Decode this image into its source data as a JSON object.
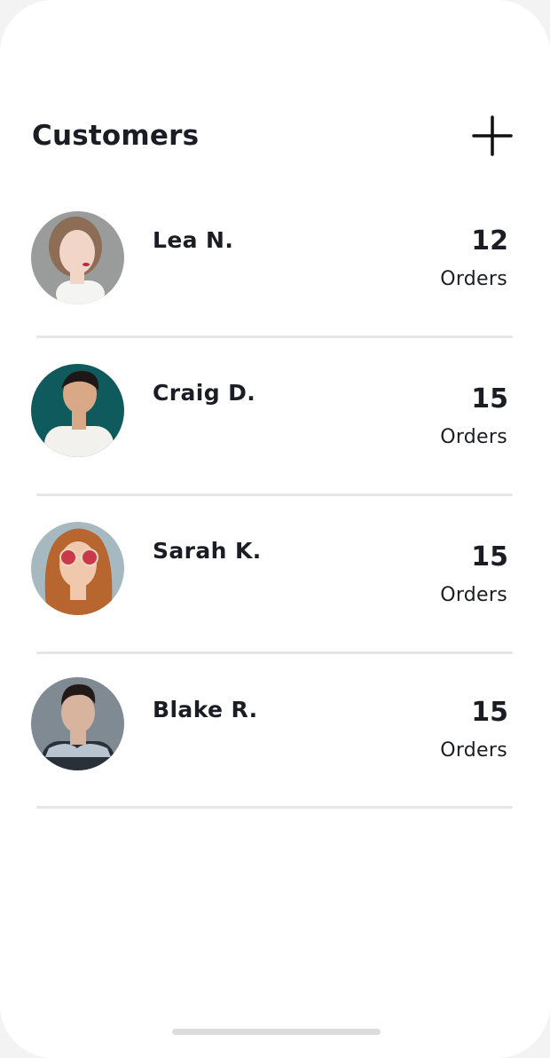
{
  "header": {
    "title": "Customers",
    "add_icon": "plus-icon"
  },
  "customers": [
    {
      "name": "Lea N.",
      "orders_count": "12",
      "orders_label": "Orders",
      "avatar": {
        "bg": "#9a9c9b",
        "skin": "#f1d6c8",
        "hair": "#8d6d55",
        "shirt": "#f4f4f2"
      }
    },
    {
      "name": "Craig D.",
      "orders_count": "15",
      "orders_label": "Orders",
      "avatar": {
        "bg": "#0f5a5c",
        "skin": "#d9a887",
        "hair": "#1d1715",
        "shirt": "#f3f1ee"
      }
    },
    {
      "name": "Sarah K.",
      "orders_count": "15",
      "orders_label": "Orders",
      "avatar": {
        "bg": "#a7b9c0",
        "skin": "#f0c8ac",
        "hair": "#b7662f",
        "shirt": "#d9a37c"
      }
    },
    {
      "name": "Blake R.",
      "orders_count": "15",
      "orders_label": "Orders",
      "avatar": {
        "bg": "#7f8a93",
        "skin": "#d8b49f",
        "hair": "#221a17",
        "shirt": "#2a3038"
      }
    }
  ],
  "colors": {
    "text": "#1b1d24",
    "divider": "#e6e6e6",
    "background": "#ffffff"
  }
}
